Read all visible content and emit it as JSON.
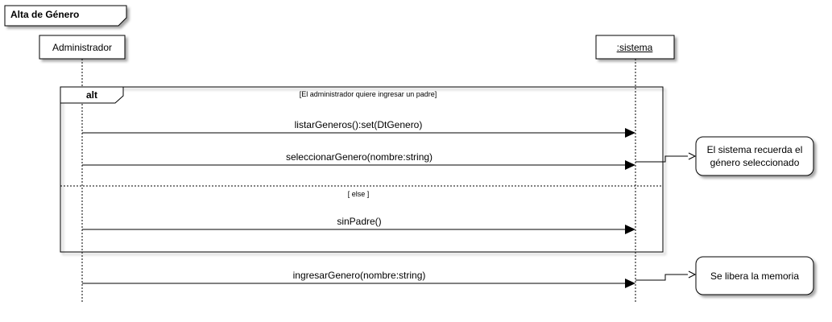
{
  "diagram": {
    "frame_title": "Alta de Género",
    "lifelines": {
      "admin": "Administrador",
      "sistema": ":sistema"
    },
    "fragment": {
      "operator": "alt",
      "guard_if": "[El administrador quiere ingresar un padre]",
      "guard_else": "[ else ]"
    },
    "messages": [
      "listarGeneros():set(DtGenero)",
      "seleccionarGenero(nombre:string)",
      "sinPadre()",
      "ingresarGenero(nombre:string)"
    ],
    "notes": [
      "El sistema recuerda el género seleccionado",
      "Se libera la memoria"
    ]
  }
}
